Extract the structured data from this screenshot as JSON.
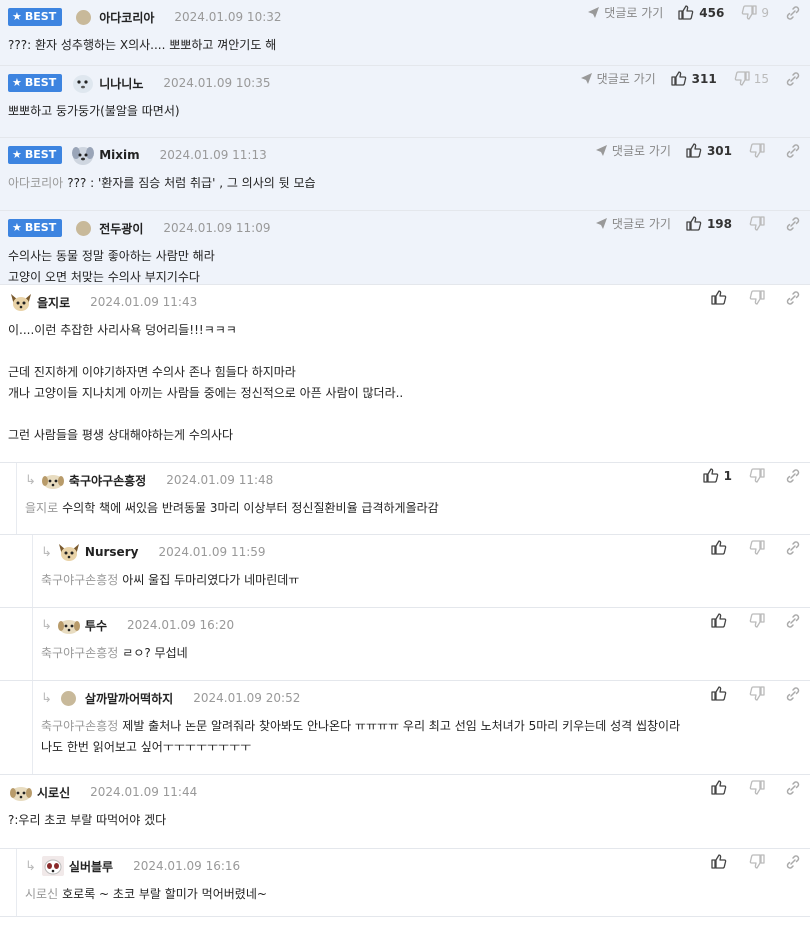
{
  "labels": {
    "best": "BEST",
    "goto": "댓글로 가기"
  },
  "comments": [
    {
      "best": true,
      "avatar": "dot-avatar",
      "nick": "아다코리아",
      "date": "2024.01.09 10:32",
      "up": "456",
      "down": "9",
      "lines": [
        "???: 환자 성추행하는 X의사.... 뽀뽀하고 껴안기도 해"
      ]
    },
    {
      "best": true,
      "avatar": "seal-avatar",
      "nick": "니나니노",
      "date": "2024.01.09 10:35",
      "up": "311",
      "down": "15",
      "lines": [
        "뽀뽀하고 둥가둥가(불알을 따면서)"
      ]
    },
    {
      "best": true,
      "avatar": "dog-avatar",
      "nick": "Mixim",
      "date": "2024.01.09 11:13",
      "up": "301",
      "down": "",
      "ref": "아다코리아",
      "lines": [
        "??? : '환자를 짐승 처럼 취급' , 그 의사의 뒷 모습"
      ]
    },
    {
      "best": true,
      "avatar": "dot-avatar",
      "nick": "전두광이",
      "date": "2024.01.09 11:09",
      "up": "198",
      "down": "",
      "lines": [
        "수의사는 동물 정말 좋아하는 사람만 해라",
        "고양이 오면 처맞는 수의사 부지기수다"
      ]
    },
    {
      "best": false,
      "avatar": "fox-avatar",
      "nick": "을지로",
      "date": "2024.01.09 11:43",
      "up": "",
      "down": "",
      "lines": [
        "이....이런 추잡한 사리사욕 덩어리들!!!ㅋㅋㅋ",
        "",
        "근데 진지하게 이야기하자면 수의사 존나 힘들다 하지마라",
        "개나 고양이들 지나치게 아끼는 사람들 중에는 정신적으로 아픈 사람이 많더라..",
        "",
        "그런 사람들을 평생 상대해야하는게 수의사다"
      ]
    },
    {
      "best": false,
      "depth": 1,
      "avatar": "puppy-avatar",
      "nick": "축구야구손흥정",
      "date": "2024.01.09 11:48",
      "up": "1",
      "down": "",
      "ref": "을지로",
      "lines": [
        "수의학 책에 써있음 반려동물 3마리 이상부터 정신질환비율 급격하게올라감"
      ]
    },
    {
      "best": false,
      "depth": 2,
      "avatar": "fox-avatar",
      "nick": "Nursery",
      "date": "2024.01.09 11:59",
      "up": "",
      "down": "",
      "ref": "축구야구손흥정",
      "lines": [
        "아씨 울집 두마리였다가 네마린데ㅠ"
      ]
    },
    {
      "best": false,
      "depth": 2,
      "avatar": "puppy-avatar",
      "nick": "투수",
      "date": "2024.01.09 16:20",
      "up": "",
      "down": "",
      "ref": "축구야구손흥정",
      "lines": [
        "ㄹㅇ? 무섭네"
      ]
    },
    {
      "best": false,
      "depth": 2,
      "avatar": "dot-avatar",
      "nick": "살까말까어떡하지",
      "date": "2024.01.09 20:52",
      "up": "",
      "down": "",
      "ref": "축구야구손흥정",
      "lines": [
        "제발 출처나 논문 알려줘라 찾아봐도 안나온다 ㅠㅠㅠㅠ 우리 최고 선임 노처녀가 5마리 키우는데 성격 씹창이라",
        "나도 한번 읽어보고 싶어ㅜㅜㅜㅜㅜㅜㅜㅜ"
      ]
    },
    {
      "best": false,
      "avatar": "puppy-avatar",
      "nick": "시로신",
      "date": "2024.01.09 11:44",
      "up": "",
      "down": "",
      "lines": [
        "?:우리 초코 부랄 따먹어야 겠다"
      ]
    },
    {
      "best": false,
      "depth": 1,
      "avatar": "panda-avatar",
      "nick": "실버블루",
      "date": "2024.01.09 16:16",
      "up": "",
      "down": "",
      "ref": "시로신",
      "lines": [
        "호로록 ~ 초코 부랄 할미가 먹어버렸네~"
      ]
    }
  ]
}
